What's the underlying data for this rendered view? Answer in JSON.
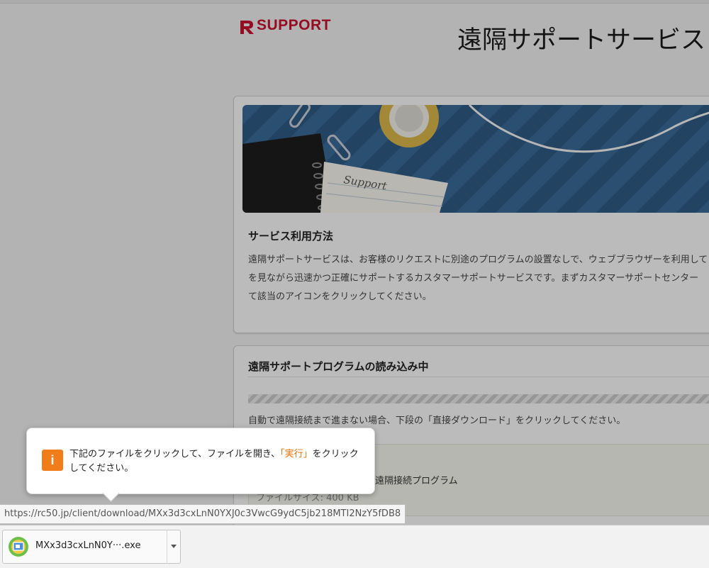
{
  "header": {
    "logo_text": "SUPPORT",
    "site_title": "遠隔サポートサービス"
  },
  "card_service": {
    "banner_note": "Support",
    "heading": "サービス利用方法",
    "body_lines": [
      "遠隔サポートサービスは、お客様のリクエストに別途のプログラムの設置なしで、ウェブブラウザーを利用して",
      "を見ながら迅速かつ正確にサポートするカスタマーサポートサービスです。まずカスタマーサポートセンター",
      "て該当のアイコンをクリックしてください。"
    ]
  },
  "card_loading": {
    "heading": "遠隔サポートプログラムの読み込み中",
    "progress": 1.0,
    "fallback_text": "自動で遠隔接続まで進まない場合、下段の「直接ダウンロード」をクリックしてください。",
    "program_label": "の遠隔接続プログラム",
    "file_size_label": "ファイルサイズ: 400 KB"
  },
  "tooltip": {
    "icon_char": "i",
    "text_before": "下記のファイルをクリックして、ファイルを開き、",
    "text_highlight": "「実行」",
    "text_after": "をクリックしてください。"
  },
  "status_url": "https://rc50.jp/client/download/MXx3d3cxLnN0YXJ0c3VwcG9ydC5jb218MTI2NzY5fDB8",
  "download": {
    "filename": "MXx3d3cxLnN0Y···.exe"
  },
  "colors": {
    "brand_red": "#c8102e",
    "accent_orange": "#f07c1a",
    "banner_blue": "#2f5a84"
  }
}
